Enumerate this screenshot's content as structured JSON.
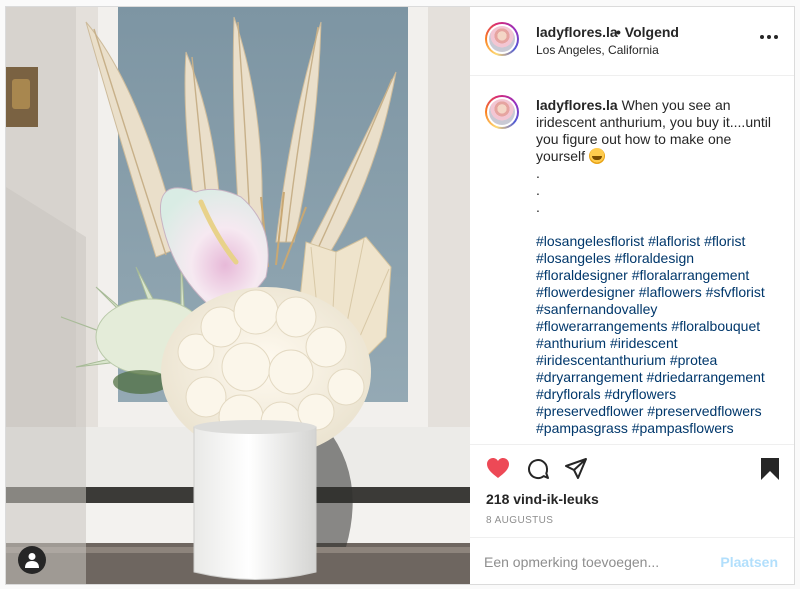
{
  "post": {
    "username": "ladyflores.la",
    "follow_separator": "•",
    "follow_label": "Volgend",
    "location": "Los Angeles, California",
    "more_icon": "more-horizontal-icon"
  },
  "caption": {
    "username": "ladyflores.la",
    "text": "When you see an iridescent anthurium, you buy it....until you figure out how to make one yourself",
    "emoji": "star-struck-emoji",
    "dots": [
      ".",
      ".",
      "."
    ],
    "hashtags": [
      "#losangelesflorist",
      "#laflorist",
      "#florist",
      "#losangeles",
      "#floraldesign",
      "#floraldesigner",
      "#floralarrangement",
      "#flowerdesigner",
      "#laflowers",
      "#sfvflorist",
      "#sanfernandovalley",
      "#flowerarrangements",
      "#floralbouquet",
      "#anthurium",
      "#iridescent",
      "#iridescentanthurium",
      "#protea",
      "#dryarrangement",
      "#driedarrangement",
      "#dryflorals",
      "#dryflowers",
      "#preservedflower",
      "#preservedflowers",
      "#pampasgrass",
      "#pampasflowers"
    ]
  },
  "actions": {
    "like_icon": "heart-filled-icon",
    "comment_icon": "comment-icon",
    "share_icon": "paper-plane-icon",
    "save_icon": "bookmark-filled-icon",
    "likes_label": "218 vind-ik-leuks",
    "date": "8 AUGUSTUS"
  },
  "comment": {
    "placeholder": "Een opmerking toevoegen...",
    "post_label": "Plaatsen"
  },
  "photo": {
    "user_tag_icon": "user-tag-icon",
    "alt": "Dried pampas floral arrangement with iridescent anthurium in white vase"
  },
  "colors": {
    "like_red": "#ed4956",
    "hashtag_blue": "#00376b",
    "post_button_disabled": "#b2dffc",
    "border": "#dbdbdb"
  }
}
